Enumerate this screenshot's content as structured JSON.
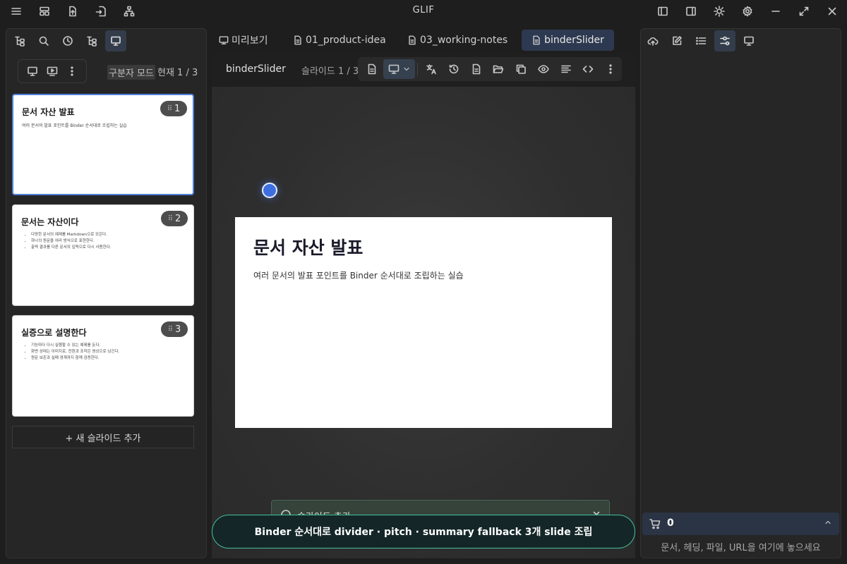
{
  "app": {
    "title": "GLIF"
  },
  "left_panel": {
    "mode_label": "구분자 모드",
    "current_label": "현재 1 / 3",
    "slides": [
      {
        "number": "1",
        "title": "문서 자산 발표",
        "subtitle": "여러 문서의 발표 포인트를 Binder 순서대로 조립하는 실습",
        "bullets": []
      },
      {
        "number": "2",
        "title": "문서는 자산이다",
        "subtitle": "",
        "bullets": [
          "다양한 문서의 예제를 Markdown으로 모은다.",
          "하나의 원문을 여러 방식으로 표현한다.",
          "출력 결과를 다른 문서의 입력으로 다시 사용한다."
        ]
      },
      {
        "number": "3",
        "title": "실증으로 설명한다",
        "subtitle": "",
        "bullets": [
          "기능마다 다시 실행할 수 있는 예제를 둔다.",
          "화면 상태는 이미지로, 전환과 조작은 영상으로 남긴다.",
          "원문 보존과 실패 경계까지 함께 검증한다."
        ]
      }
    ],
    "add_slide_label": "+ 새 슬라이드 추가"
  },
  "tabs": [
    {
      "label": "미리보기",
      "icon": "monitor-icon"
    },
    {
      "label": "01_product-idea",
      "icon": "document-icon"
    },
    {
      "label": "03_working-notes",
      "icon": "document-icon"
    },
    {
      "label": "binderSlider",
      "icon": "document-icon",
      "active": true
    }
  ],
  "doc": {
    "title": "binderSlider",
    "counter": "슬라이드 1 / 3"
  },
  "main_slide": {
    "title": "문서 자산 발표",
    "subtitle": "여러 문서의 발표 포인트를 Binder 순서대로 조립하는 실습"
  },
  "notes": {
    "label": "슬라이드 추가"
  },
  "toast": {
    "message": "Binder 순서대로 divider · pitch · summary fallback 3개 slide 조립"
  },
  "right_panel": {
    "basket_count": "0",
    "drop_hint": "문서, 헤딩, 파일, URL을 여기에 놓으세요"
  }
}
